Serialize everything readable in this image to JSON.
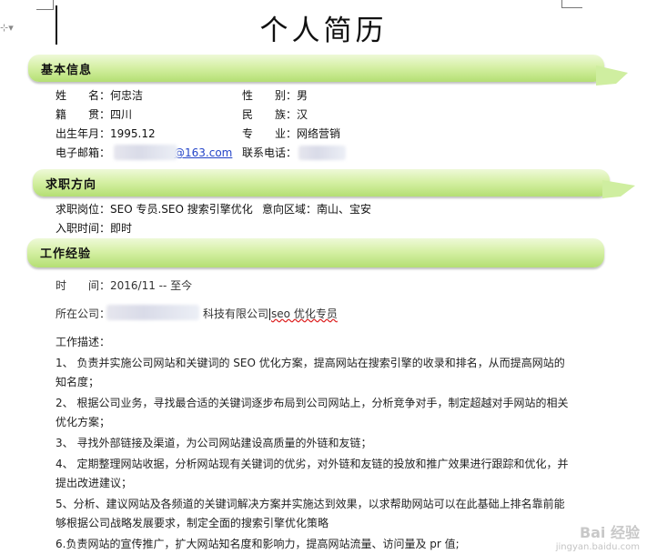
{
  "title": "个人简历",
  "sections": {
    "basic": "基本信息",
    "intent": "求职方向",
    "work": "工作经验"
  },
  "basic": {
    "name_label": "姓　　名：",
    "name_value": "何忠洁",
    "gender_label": "性　　别：",
    "gender_value": "男",
    "origin_label": "籍　　贯：",
    "origin_value": "四川",
    "ethnic_label": "民　　族：",
    "ethnic_value": "汉",
    "birth_label": "出生年月：",
    "birth_value": "1995.12",
    "major_label": "专　　业：",
    "major_value": "网络营销",
    "email_label": "电子邮箱：",
    "email_value": "@163.com",
    "phone_label": "联系电话："
  },
  "intent": {
    "position_label": "求职岗位：",
    "position_value": "SEO 专员.SEO 搜索引擎优化",
    "area_label": "意向区域：",
    "area_value": "南山、宝安",
    "start_label": "入职时间：",
    "start_value": "即时"
  },
  "work": {
    "time_label": "时　　间：",
    "time_value": "2016/11 -- 至今",
    "company_label": "所在公司：",
    "company_suffix": "科技有限公司",
    "role_value": "seo 优化专员",
    "desc_label": "工作描述：",
    "items": [
      "1、 负责并实施公司网站和关键词的 SEO 优化方案，提高网站在搜索引擎的收录和排名，从而提高网站的知名度；",
      "2、 根据公司业务，寻找最合适的关键词逐步布局到公司网站上，分析竞争对手，制定超越对手网站的相关优化方案；",
      "3、 寻找外部链接及渠道，为公司网站建设高质量的外链和友链；",
      "4、 定期整理网站收据，分析网站现有关键词的优劣，对外链和友链的投放和推广效果进行跟踪和优化，并提出改进建议；",
      "5、分析、建议网站及各频道的关键词解决方案并实施达到效果，以求帮助网站可以在此基础上排名靠前能够根据公司战略发展要求，制定全面的搜索引擎优化策略",
      "6.负责网站的宣传推广，扩大网站知名度和影响力，提高网站流量、访问量及 pr 值;"
    ]
  },
  "watermark": {
    "brand": "Bai 经验",
    "url": "jingyan.baidu.com"
  },
  "colors": {
    "band_light": "#eef9d8",
    "band_dark": "#b4df73",
    "link": "#2344c8"
  }
}
